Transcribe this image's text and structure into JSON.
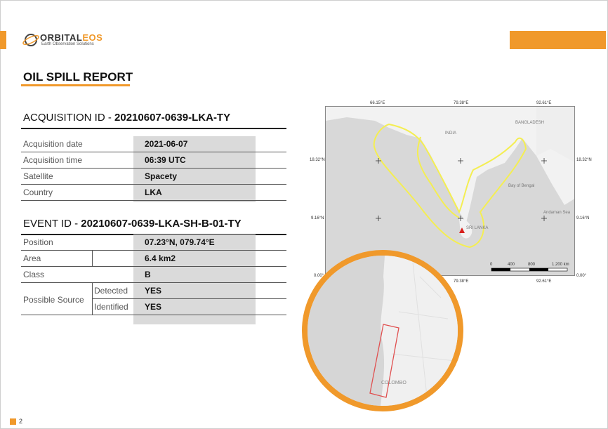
{
  "brand": {
    "name_prefix": "ORBITAL",
    "name_suffix": "EOS",
    "tagline": "Earth Observation Solutions",
    "accent_color": "#f0992b"
  },
  "report": {
    "title": "OIL SPILL REPORT"
  },
  "acquisition": {
    "heading_prefix": "ACQUISITION ID - ",
    "id": "20210607-0639-LKA-TY",
    "rows": [
      {
        "label": "Acquisition date",
        "value": "2021-06-07"
      },
      {
        "label": "Acquisition time",
        "value": "06:39 UTC"
      },
      {
        "label": "Satellite",
        "value": "Spacety"
      },
      {
        "label": "Country",
        "value": "LKA"
      }
    ]
  },
  "event": {
    "heading_prefix": "EVENT ID -  ",
    "id": "20210607-0639-LKA-SH-B-01-TY",
    "rows": [
      {
        "label": "Position",
        "value": "07.23°N, 079.74°E"
      },
      {
        "label": "Area",
        "value": "6.4 km2"
      },
      {
        "label": "Class",
        "value": "B"
      }
    ],
    "possible_source": {
      "label": "Possible Source",
      "detected_label": "Detected",
      "detected_value": "YES",
      "identified_label": "Identified",
      "identified_value": "YES"
    }
  },
  "map": {
    "top_lon_labels": [
      "66.15°E",
      "79.38°E",
      "92.61°E"
    ],
    "bottom_lon_labels": [
      "79.38°E",
      "92.61°E"
    ],
    "left_lat_labels": [
      "18.32°N",
      "9.16°N",
      "0.00°"
    ],
    "right_lat_labels": [
      "18.32°N",
      "9.16°N",
      "0.00°"
    ],
    "scale_labels": [
      "0",
      "400",
      "800",
      "1.200 km"
    ],
    "place_labels": [
      "INDIA",
      "BANGLADESH",
      "Bay of Bengal",
      "Andaman Sea",
      "SRI LANKA"
    ],
    "inset_labels": [
      "COLOMBO"
    ]
  },
  "footer": {
    "page_number": "2"
  }
}
